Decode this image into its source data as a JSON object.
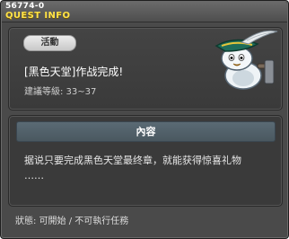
{
  "window": {
    "quest_id": "56774-0",
    "title": "QUEST INFO"
  },
  "summary": {
    "category_badge": "活動",
    "quest_name": "[黑色天堂]作战完成!",
    "level_requirement": "建議等級: 33~37"
  },
  "details": {
    "section_title": "內容",
    "description": "据说只要完成黑色天堂最终章，就能获得惊喜礼物\n……"
  },
  "footer": {
    "status": "狀態: 可開始 / 不可執行任務"
  },
  "npc": {
    "icon": "penguin-musketeer-icon"
  }
}
